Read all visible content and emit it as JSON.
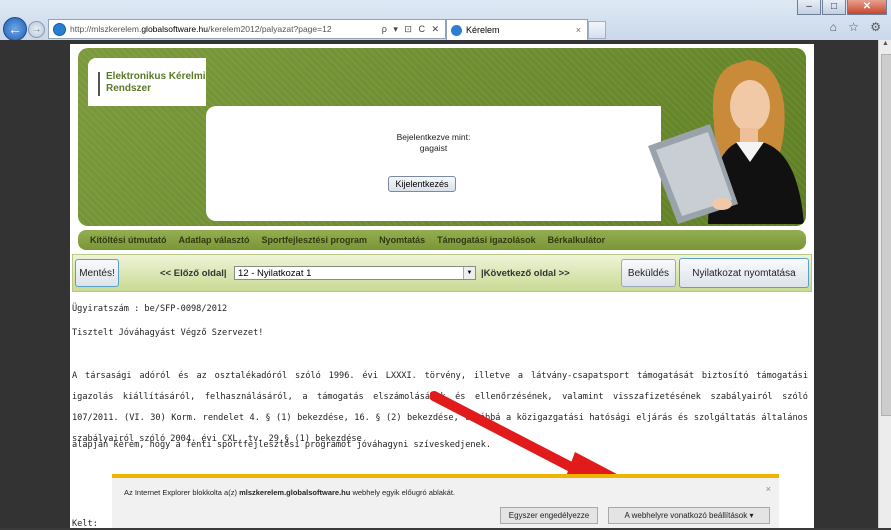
{
  "browser": {
    "url_prefix": "http://mlszkerelem.",
    "url_domain": "globalsoftware.hu",
    "url_path": "/kerelem2012/palyazat?page=12",
    "address_tools": "ρ ▾ ⊡ C ✕",
    "tab_title": "Kérelem",
    "tab_close": "×",
    "right_icons": "⌂ ☆ ⚙"
  },
  "header": {
    "logo_line1": "Elektronikus Kérelmi",
    "logo_line2": "Rendszer",
    "logged_in_label": "Bejelentkezve mint:",
    "username": "gagaist",
    "logout_label": "Kijelentkezés"
  },
  "menu": {
    "items": [
      "Kitöltési útmutató",
      "Adatlap választó",
      "Sportfejlesztési program",
      "Nyomtatás",
      "Támogatási igazolások",
      "Bérkalkulátor"
    ]
  },
  "navbar": {
    "save_label": "Mentés!",
    "prev_label": "<< Előző oldal|",
    "page_select_value": "12 - Nyilatkozat 1",
    "next_label": "|Következő oldal >>",
    "submit_label": "Beküldés",
    "print_label": "Nyilatkozat nyomtatása"
  },
  "content": {
    "reference": "Ügyiratszám : be/SFP-0098/2012",
    "greeting": "Tisztelt Jóváhagyást Végző Szervezet!",
    "paragraph": "A társasági adóról és az osztalékadóról szóló 1996. évi LXXXI. törvény, illetve a látvány-csapatsport támogatását biztosító támogatási igazolás kiállításáról, felhasználásáról, a támogatás elszámolásának és ellenőrzésének, valamint visszafizetésének szabályairól szóló 107/2011. (VI. 30) Korm. rendelet 4. § (1) bekezdése, 16. § (2) bekezdése, továbbá a közigazgatási hatósági eljárás és szolgáltatás általános szabályairól szóló 2004. évi CXL. tv. 29.§ (1) bekezdése",
    "paragraph_last": "alapján kérem, hogy a fenti sportfejlesztési programot jóváhagyni szíveskedjenek.",
    "kelt": "Kelt:"
  },
  "popup": {
    "msg_prefix": "Az Internet Explorer blokkolta a(z) ",
    "msg_site": "mlszkerelem.globalsoftware.hu",
    "msg_suffix": " webhely egyik előugró ablakát.",
    "allow_once": "Egyszer engedélyezze",
    "site_options": "A webhelyre vonatkozó beállítások ▾",
    "close": "×"
  },
  "colors": {
    "header_green": "#6d8c2e",
    "menu_green": "#8aa346",
    "navbar_bg": "#dce8b4",
    "popup_accent": "#f0b400",
    "arrow_red": "#e11b1b"
  }
}
